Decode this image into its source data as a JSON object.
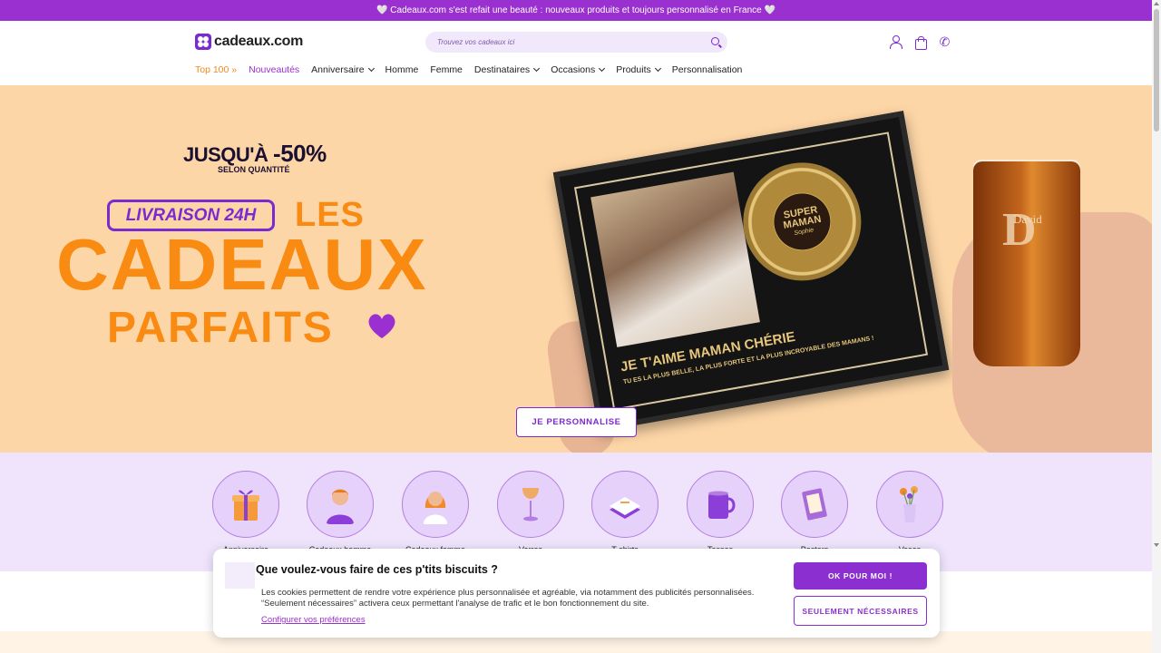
{
  "topbar": {
    "announcement": "🤍 Cadeaux.com s'est refait une beauté : nouveaux produits et toujours personnalisé en France 🤍"
  },
  "header": {
    "logo": "cadeaux.com",
    "search_placeholder": "Trouvez vos cadeaux ici",
    "nav": [
      {
        "label": "Top 100 »"
      },
      {
        "label": "Nouveautés"
      },
      {
        "label": "Anniversaire"
      },
      {
        "label": "Homme"
      },
      {
        "label": "Femme"
      },
      {
        "label": "Destinataires"
      },
      {
        "label": "Occasions"
      },
      {
        "label": "Produits"
      },
      {
        "label": "Personnalisation"
      }
    ]
  },
  "hero": {
    "promo_prefix": "JUSQU'À",
    "promo_value": "-50%",
    "promo_sub": "SELON QUANTITÉ",
    "badge": "LIVRAISON 24H",
    "headline_1": "LES",
    "headline_2": "CADEAUX",
    "headline_3": "PARFAITS",
    "record_line1": "SUPER",
    "record_line2": "MAMAN",
    "record_sign": "Sophie",
    "caption_main": "JE T'AIME MAMAN CHÉRIE",
    "caption_sub": "TU ES LA PLUS BELLE, LA PLUS FORTE ET LA PLUS INCROYABLE DES MAMANS !",
    "glass_initial": "D",
    "glass_name": "David",
    "cta": "JE PERSONNALISE"
  },
  "categories": [
    {
      "label": "Anniversaire",
      "icon": "gift-icon",
      "color": "#f59a3a"
    },
    {
      "label": "Cadeaux homme",
      "icon": "man-icon",
      "color": "#8b3fd8"
    },
    {
      "label": "Cadeaux femme",
      "icon": "woman-icon",
      "color": "#f08a2a"
    },
    {
      "label": "Verres",
      "icon": "wine-glass-icon",
      "color": "#f0a34a"
    },
    {
      "label": "T-shirts",
      "icon": "tshirt-icon",
      "color": "#b47ee0"
    },
    {
      "label": "Tasses",
      "icon": "mug-icon",
      "color": "#8b3fd8"
    },
    {
      "label": "Posters",
      "icon": "poster-icon",
      "color": "#a86ad8"
    },
    {
      "label": "Vases",
      "icon": "vase-icon",
      "color": "#f08a2a"
    }
  ],
  "cookie": {
    "title": "Que voulez-vous faire de ces p'tits biscuits ?",
    "text_1": "Les cookies permettent de rendre votre expérience plus personnalisée et agréable, via notamment des publicités personnalisées.",
    "text_2": "“Seulement nécessaires” activera ceux permettant l'analyse de trafic et le bon fonctionnement du site.",
    "link": "Configurer vos préférences",
    "btn_ok": "OK POUR MOI !",
    "btn_necessary": "SEULEMENT NÉCESSAIRES"
  },
  "colors": {
    "brand": "#9b30d0",
    "accent": "#f98a12",
    "hero_bg": "#fdd6a7",
    "cats_bg": "#efe4fc"
  }
}
